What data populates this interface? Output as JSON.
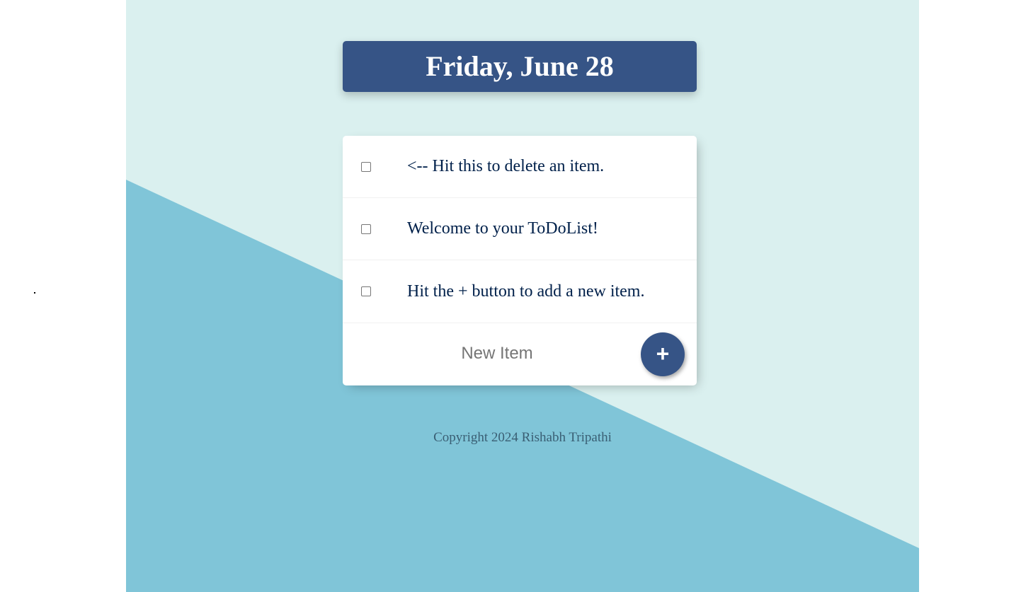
{
  "colors": {
    "page_background": "#ffffff",
    "light_band": "#daf0ef",
    "dark_band": "#80c5d8",
    "primary": "#365486",
    "text": "#00204a"
  },
  "heading": {
    "title": "Friday, June 28"
  },
  "items": [
    {
      "label": "<-- Hit this to delete an item.",
      "checked": false
    },
    {
      "label": "Welcome to your ToDoList!",
      "checked": false
    },
    {
      "label": "Hit the + button to add a new item.",
      "checked": false
    }
  ],
  "new_item": {
    "placeholder": "New Item",
    "value": "",
    "add_button_label": "+",
    "add_button_icon": "plus-icon"
  },
  "footer": {
    "copyright": "Copyright 2024 Rishabh Tripathi"
  }
}
